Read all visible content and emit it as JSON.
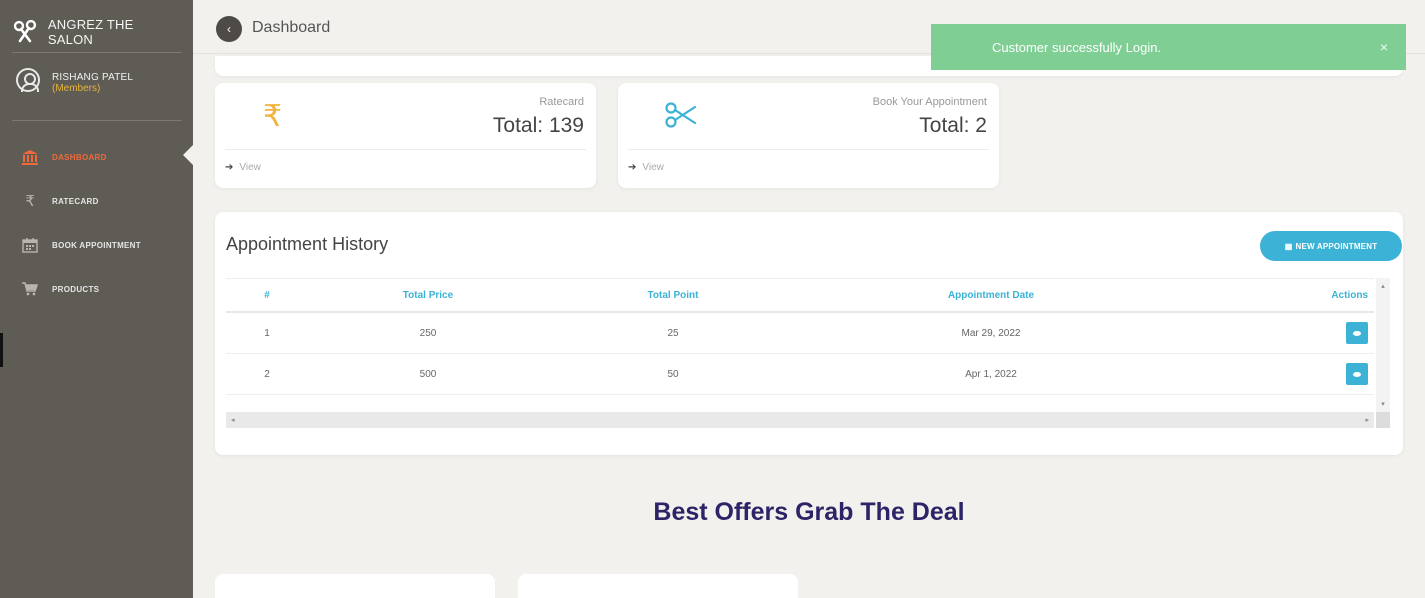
{
  "sidebar": {
    "brand": "ANGREZ THE SALON",
    "user": {
      "name": "RISHANG PATEL",
      "role": "(Members)"
    },
    "items": [
      {
        "label": "DASHBOARD",
        "icon": "bank-icon",
        "active": true
      },
      {
        "label": "RATECARD",
        "icon": "rupee-icon",
        "active": false
      },
      {
        "label": "BOOK APPOINTMENT",
        "icon": "calendar-icon",
        "active": false
      },
      {
        "label": "PRODUCTS",
        "icon": "cart-icon",
        "active": false
      }
    ]
  },
  "header": {
    "title": "Dashboard"
  },
  "toast": {
    "message": "Customer successfully Login.",
    "close": "×"
  },
  "stats": [
    {
      "caption": "Ratecard",
      "total": "Total: 139",
      "view": "View",
      "icon": "rupee-icon",
      "color": "#f3b33d"
    },
    {
      "caption": "Book Your Appointment",
      "total": "Total: 2",
      "view": "View",
      "icon": "scissors-icon",
      "color": "#3cb3d6"
    }
  ],
  "history": {
    "title": "Appointment History",
    "new_button": "NEW APPOINTMENT",
    "columns": [
      "#",
      "Total Price",
      "Total Point",
      "Appointment Date",
      "Actions"
    ],
    "rows": [
      {
        "no": "1",
        "price": "250",
        "point": "25",
        "date": "Mar 29, 2022"
      },
      {
        "no": "2",
        "price": "500",
        "point": "50",
        "date": "Apr 1, 2022"
      }
    ]
  },
  "offers": {
    "title": "Best Offers Grab The Deal"
  },
  "colors": {
    "accent": "#3cb3d6",
    "active_nav": "#ef6a3a",
    "sidebar": "#5f5b55",
    "toast": "#7fcf95",
    "offers_title": "#2c2466"
  }
}
